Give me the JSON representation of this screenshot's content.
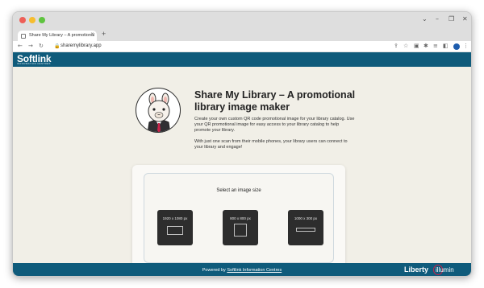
{
  "browser": {
    "tab_title": "Share My Library – A promotional",
    "tab_close": "×",
    "new_tab": "+",
    "url": "sharemylibrary.app",
    "lock_icon": "lock-icon",
    "window_controls": [
      "⌄",
      "–",
      "❐",
      "✕"
    ]
  },
  "header": {
    "logo": "Softlink",
    "logo_sub": "INFORMATION CENTRES"
  },
  "main": {
    "title": "Share My Library – A promotional library image maker",
    "para1": "Create your own custom QR code promotional image for your library catalog. Use your QR promotional image for easy access to your library catalog to help promote your library.",
    "para2": "With just one scan from their mobile phones, your library users can connect to your library and engage!",
    "avatar_icon": "alpaca-mascot-icon"
  },
  "selector": {
    "title": "Select an image size",
    "options": [
      {
        "label": "1920 x 1080 px",
        "shape": "landscape"
      },
      {
        "label": "800 x 800 px",
        "shape": "square"
      },
      {
        "label": "1000 x 300 px",
        "shape": "banner"
      }
    ]
  },
  "footer": {
    "powered_by": "Powered by ",
    "link": "Softlink Information Centres",
    "brand1": "Liberty",
    "brand2": "illumin"
  },
  "colors": {
    "brand": "#0f5b7b",
    "page_bg": "#f1efe7",
    "tile": "#2d2d2d",
    "accent": "#c8234a"
  }
}
